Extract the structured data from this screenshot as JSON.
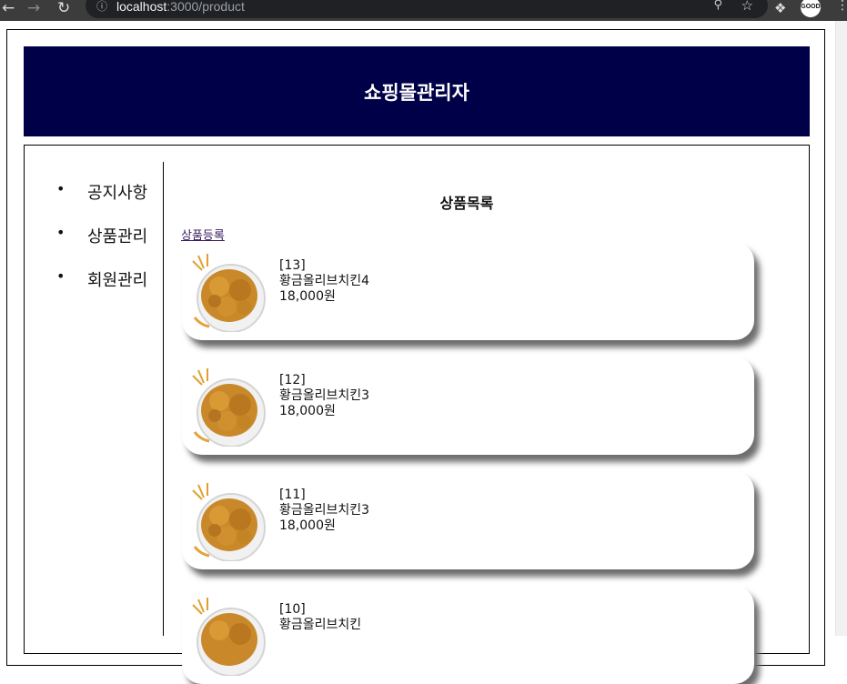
{
  "browser": {
    "url_host": "localhost",
    "url_path": ":3000/product",
    "avatar_text": "GOOD"
  },
  "header": {
    "title": "쇼핑몰관리자"
  },
  "sidebar": {
    "items": [
      {
        "label": "공지사항"
      },
      {
        "label": "상품관리"
      },
      {
        "label": "회원관리"
      }
    ]
  },
  "main": {
    "title": "상품목록",
    "add_link": "상품등록",
    "products": [
      {
        "id": "[13]",
        "name": "황금올리브치킨4",
        "price": "18,000원"
      },
      {
        "id": "[12]",
        "name": "황금올리브치킨3",
        "price": "18,000원"
      },
      {
        "id": "[11]",
        "name": "황금올리브치킨3",
        "price": "18,000원"
      },
      {
        "id": "[10]",
        "name": "황금올리브치킨",
        "price": ""
      }
    ]
  },
  "colors": {
    "header_bg": "#000048",
    "header_text": "#ffffff"
  }
}
